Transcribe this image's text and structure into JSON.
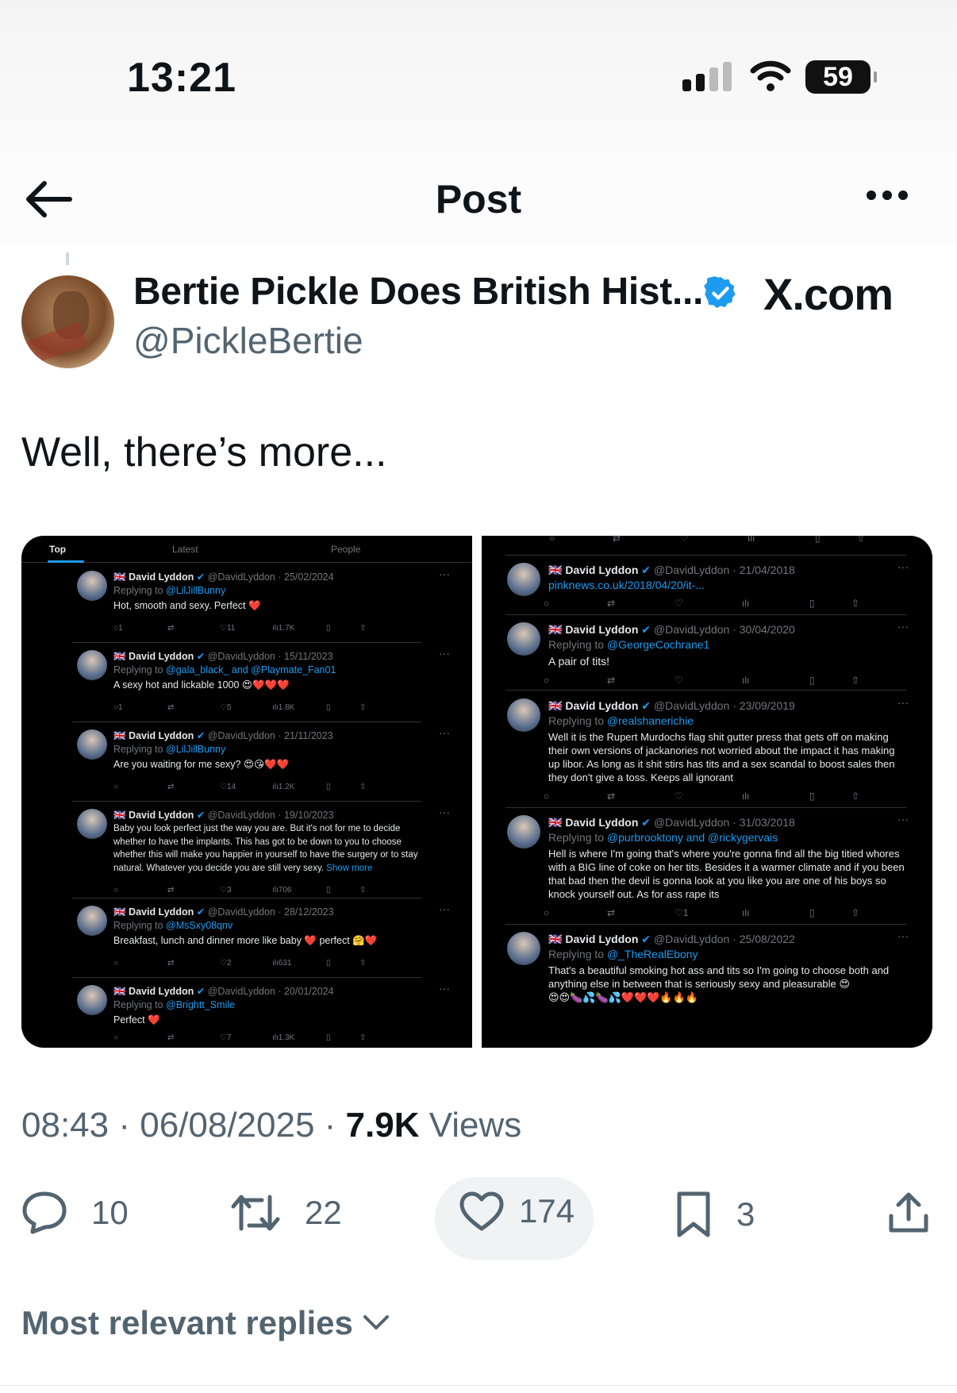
{
  "status_bar": {
    "time": "13:21",
    "battery": "59"
  },
  "header": {
    "title": "Post"
  },
  "author": {
    "name": "Bertie Pickle Does British Hist...",
    "handle": "@PickleBertie",
    "watermark": "X.com"
  },
  "post_text": "Well, there’s more...",
  "left_screenshot": {
    "tabs": [
      "Top",
      "Latest",
      "People"
    ],
    "tweets": [
      {
        "name": "David Lyddon",
        "handle_date": "@DavidLyddon · 25/02/2024",
        "reply_label": "Replying to ",
        "reply_to": "@LilJillBunny",
        "text": "Hot, smooth and sexy. Perfect ❤️",
        "comments": "1",
        "likes": "11",
        "views": "1.7K"
      },
      {
        "name": "David Lyddon",
        "handle_date": "@DavidLyddon · 15/11/2023",
        "reply_label": "Replying to ",
        "reply_to": "@gala_black_ and @Playmate_Fan01",
        "text": "A sexy hot and lickable 1000 😍❤️❤️❤️",
        "comments": "1",
        "likes": "5",
        "views": "1.8K"
      },
      {
        "name": "David Lyddon",
        "handle_date": "@DavidLyddon · 21/11/2023",
        "reply_label": "Replying to ",
        "reply_to": "@LilJillBunny",
        "text": "Are you waiting for me sexy? 😍😘❤️❤️",
        "comments": "",
        "likes": "14",
        "views": "1.2K"
      },
      {
        "name": "David Lyddon",
        "handle_date": "@DavidLyddon · 19/10/2023",
        "reply_label": "",
        "reply_to": "",
        "text": "Baby you look perfect just the way you are. But it's not for me to decide whether to have the implants. This has got to be down to you to choose whether this will make you happier in yourself to have the surgery or to stay natural. Whatever you decide you are still very sexy.",
        "show_more": "Show more",
        "comments": "",
        "likes": "3",
        "views": "706"
      },
      {
        "name": "David Lyddon",
        "handle_date": "@DavidLyddon · 28/12/2023",
        "reply_label": "Replying to ",
        "reply_to": "@MsSxy08qnv",
        "text": "Breakfast, lunch and dinner more like baby ❤️ perfect 🤗❤️",
        "comments": "",
        "likes": "2",
        "views": "631"
      },
      {
        "name": "David Lyddon",
        "handle_date": "@DavidLyddon · 20/01/2024",
        "reply_label": "Replying to ",
        "reply_to": "@Brightt_Smile",
        "text": "Perfect ❤️",
        "comments": "",
        "likes": "7",
        "views": "1.3K"
      }
    ]
  },
  "right_screenshot": {
    "tweets": [
      {
        "name": "David Lyddon",
        "handle_date": "@DavidLyddon · 21/04/2018",
        "reply_label": "",
        "reply_to": "pinknews.co.uk/2018/04/20/it-...",
        "text": "",
        "likes": ""
      },
      {
        "name": "David Lyddon",
        "handle_date": "@DavidLyddon · 30/04/2020",
        "reply_label": "Replying to ",
        "reply_to": "@GeorgeCochrane1",
        "text": "A pair of tits!",
        "likes": ""
      },
      {
        "name": "David Lyddon",
        "handle_date": "@DavidLyddon · 23/09/2019",
        "reply_label": "Replying to ",
        "reply_to": "@realshanerichie",
        "text": "Well it is the Rupert Murdochs flag shit gutter press that gets off on making their own versions of jackanories not worried about the impact it has making up libor. As long as it shit stirs has tits and a sex scandal to boost sales then they don't give a toss.  Keeps all ignorant",
        "likes": ""
      },
      {
        "name": "David Lyddon",
        "handle_date": "@DavidLyddon · 31/03/2018",
        "reply_label": "Replying to ",
        "reply_to": "@purbrooktony and @rickygervais",
        "text": "Hell is where I'm going that's where you're gonna find all the big titied whores with a BIG line of coke on her tits. Besides it a warmer climate and if you been that bad then the devil is gonna look at you like you are one of his boys so knock yourself out.  As for ass rape its",
        "likes": "1"
      },
      {
        "name": "David Lyddon",
        "handle_date": "@DavidLyddon · 25/08/2022",
        "reply_label": "Replying to ",
        "reply_to": "@_TheRealEbony",
        "text": "That's a beautiful smoking hot ass and tits so I'm going to choose both and anything else in between that is seriously sexy and pleasurable 😍",
        "emoji_row": "😍😍🍆💦🍆💦❤️❤️❤️🔥🔥🔥",
        "likes": ""
      }
    ]
  },
  "post_meta": {
    "time": "08:43",
    "sep1": " · ",
    "date": "06/08/2025",
    "sep2": " · ",
    "views_count": "7.9K",
    "views_label": " Views"
  },
  "actions": {
    "replies": "10",
    "reposts": "22",
    "likes": "174",
    "bookmarks": "3"
  },
  "replies_sort": "Most relevant replies"
}
